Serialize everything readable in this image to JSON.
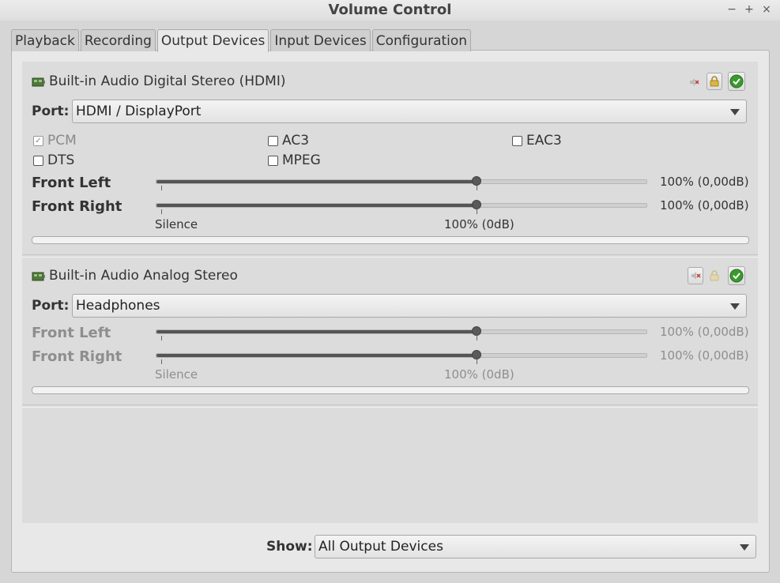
{
  "window": {
    "title": "Volume Control",
    "controls": [
      "−",
      "+",
      "×"
    ]
  },
  "tabs": [
    "Playback",
    "Recording",
    "Output Devices",
    "Input Devices",
    "Configuration"
  ],
  "active_tab": "Output Devices",
  "devices": [
    {
      "name": "Built-in Audio Digital Stereo (HDMI)",
      "port_label": "Port:",
      "port": "HDMI / DisplayPort",
      "formats": [
        {
          "label": "PCM",
          "checked": true,
          "enabled": false
        },
        {
          "label": "AC3",
          "checked": false,
          "enabled": true
        },
        {
          "label": "EAC3",
          "checked": false,
          "enabled": true
        },
        {
          "label": "DTS",
          "checked": false,
          "enabled": true
        },
        {
          "label": "MPEG",
          "checked": false,
          "enabled": true
        }
      ],
      "channels": [
        {
          "name": "Front Left",
          "value": "100% (0,00dB)",
          "level": 1.0
        },
        {
          "name": "Front Right",
          "value": "100% (0,00dB)",
          "level": 1.0
        }
      ],
      "scale": {
        "min": "Silence",
        "mid": "100% (0dB)"
      },
      "enabled": true
    },
    {
      "name": "Built-in Audio Analog Stereo",
      "port_label": "Port:",
      "port": "Headphones",
      "channels": [
        {
          "name": "Front Left",
          "value": "100% (0,00dB)",
          "level": 1.0
        },
        {
          "name": "Front Right",
          "value": "100% (0,00dB)",
          "level": 1.0
        }
      ],
      "scale": {
        "min": "Silence",
        "mid": "100% (0dB)"
      },
      "enabled": false
    }
  ],
  "show": {
    "label": "Show:",
    "value": "All Output Devices"
  },
  "colors": {
    "accent_green": "#3b9a2e",
    "mute_red": "#c0392b",
    "lock_gold": "#c9a227"
  }
}
